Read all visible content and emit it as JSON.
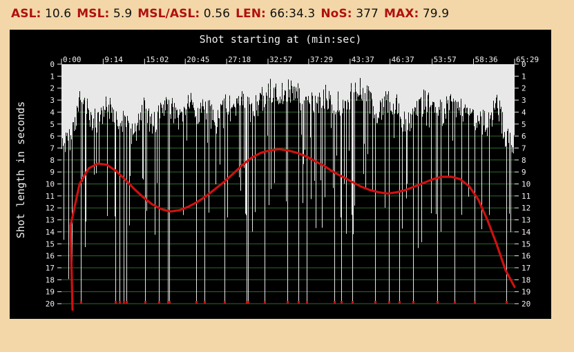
{
  "stats": [
    {
      "label": "ASL:",
      "value": "10.6"
    },
    {
      "label": "MSL:",
      "value": "5.9"
    },
    {
      "label": "MSL/ASL:",
      "value": "0.56"
    },
    {
      "label": "LEN:",
      "value": "66:34.3"
    },
    {
      "label": "NoS:",
      "value": "377"
    },
    {
      "label": "MAX:",
      "value": "79.9"
    }
  ],
  "colors": {
    "page_bg": "#f3d7a8",
    "plot_bg": "#000000",
    "bars": "#e8e8e8",
    "grid": "#2e6b2e",
    "trend": "#d01010",
    "stat_label": "#b01010"
  },
  "chart_data": {
    "type": "bar",
    "title": "Shot starting at (min:sec)",
    "ylabel": "Shot length in seconds",
    "x_ticks": [
      "0:00",
      "9:14",
      "15:02",
      "20:45",
      "27:18",
      "32:57",
      "37:29",
      "43:37",
      "46:37",
      "53:57",
      "58:36",
      "65:29"
    ],
    "x_tick_fracs": [
      0,
      0.0921,
      0.1834,
      0.2732,
      0.3645,
      0.4558,
      0.5456,
      0.6369,
      0.7251,
      0.818,
      0.9093,
      1
    ],
    "ylim": [
      0,
      20
    ],
    "y_ticks": [
      0,
      1,
      2,
      3,
      4,
      5,
      6,
      7,
      8,
      9,
      10,
      11,
      12,
      13,
      14,
      15,
      16,
      17,
      18,
      19,
      20
    ],
    "y_inverted": true,
    "grid": true,
    "bar_envelope": {
      "description": "Shot lengths (seconds) sampled along the timeline; values >= 20 are clipped and marked red at the baseline",
      "x_frac": [
        0,
        0.02,
        0.04,
        0.06,
        0.08,
        0.1,
        0.12,
        0.14,
        0.16,
        0.18,
        0.2,
        0.22,
        0.24,
        0.26,
        0.28,
        0.3,
        0.32,
        0.34,
        0.36,
        0.38,
        0.4,
        0.42,
        0.44,
        0.46,
        0.48,
        0.5,
        0.52,
        0.54,
        0.56,
        0.58,
        0.6,
        0.62,
        0.64,
        0.66,
        0.68,
        0.7,
        0.72,
        0.74,
        0.76,
        0.78,
        0.8,
        0.82,
        0.84,
        0.86,
        0.88,
        0.9,
        0.92,
        0.94,
        0.96,
        0.98,
        1
      ],
      "shot_len": [
        6,
        5,
        2,
        3,
        4,
        2.5,
        3,
        4,
        5,
        2.5,
        4,
        3,
        2.5,
        3.5,
        2,
        3,
        2.5,
        4,
        2,
        3,
        2,
        3,
        2,
        1,
        1.5,
        1,
        1.5,
        2,
        2.5,
        1.5,
        2,
        2.5,
        1.5,
        0.8,
        2,
        3,
        2,
        2.5,
        4,
        3,
        2,
        2.5,
        3,
        2,
        2.5,
        3,
        3.5,
        4,
        2,
        5,
        6
      ]
    },
    "series": [
      {
        "type": "trend",
        "x_frac": [
          0,
          0.02,
          0.04,
          0.06,
          0.08,
          0.1,
          0.12,
          0.14,
          0.16,
          0.18,
          0.2,
          0.22,
          0.24,
          0.26,
          0.28,
          0.3,
          0.32,
          0.34,
          0.36,
          0.38,
          0.4,
          0.42,
          0.44,
          0.46,
          0.48,
          0.5,
          0.52,
          0.54,
          0.56,
          0.58,
          0.6,
          0.62,
          0.64,
          0.66,
          0.68,
          0.7,
          0.72,
          0.74,
          0.76,
          0.78,
          0.8,
          0.82,
          0.84,
          0.86,
          0.88,
          0.9,
          0.92,
          0.94,
          0.96,
          0.98,
          1
        ],
        "values": [
          20.5,
          13.5,
          10.0,
          8.7,
          8.3,
          8.4,
          8.9,
          9.6,
          10.4,
          11.1,
          11.7,
          12.1,
          12.3,
          12.2,
          11.9,
          11.5,
          11.0,
          10.4,
          9.8,
          9.1,
          8.4,
          7.8,
          7.4,
          7.2,
          7.1,
          7.2,
          7.4,
          7.7,
          8.1,
          8.5,
          9.0,
          9.4,
          9.8,
          10.2,
          10.5,
          10.7,
          10.8,
          10.7,
          10.5,
          10.2,
          9.9,
          9.6,
          9.4,
          9.4,
          9.6,
          10.2,
          11.3,
          13.0,
          15.0,
          17.2,
          18.6
        ]
      }
    ]
  }
}
